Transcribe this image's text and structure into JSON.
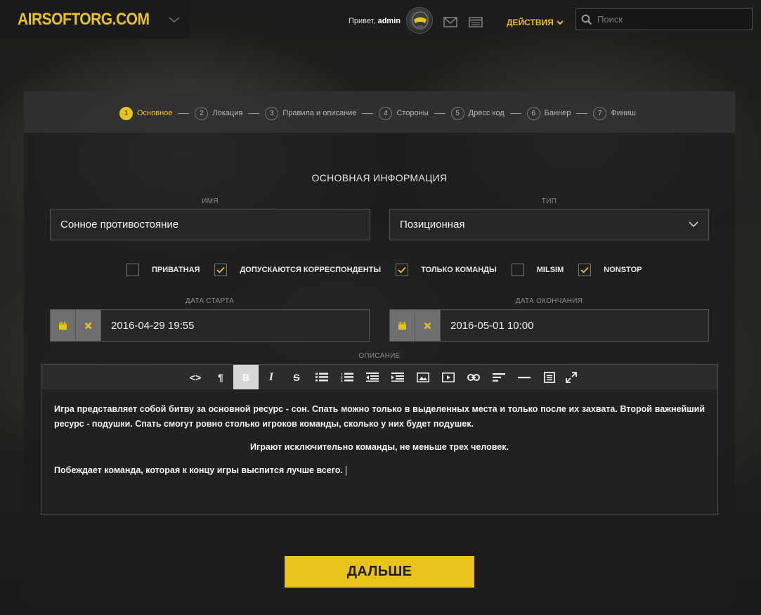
{
  "header": {
    "logo_text": "AIRSOFTORG.COM",
    "greeting_prefix": "Привет,",
    "username": "admin",
    "actions_label": "ДЕЙСТВИЯ",
    "search_placeholder": "Поиск",
    "icons": [
      "chevron-down-icon",
      "avatar",
      "mail-icon",
      "news-icon",
      "search-icon"
    ]
  },
  "steps": [
    {
      "num": "1",
      "label": "Основное",
      "active": true
    },
    {
      "num": "2",
      "label": "Локация",
      "active": false
    },
    {
      "num": "3",
      "label": "Правила и описание",
      "active": false
    },
    {
      "num": "4",
      "label": "Стороны",
      "active": false
    },
    {
      "num": "5",
      "label": "Дресс код",
      "active": false
    },
    {
      "num": "6",
      "label": "Баннер",
      "active": false
    },
    {
      "num": "7",
      "label": "Финиш",
      "active": false
    }
  ],
  "form": {
    "section_title": "ОСНОВНАЯ ИНФОРМАЦИЯ",
    "name_label": "ИМЯ",
    "name_value": "Сонное противостояние",
    "type_label": "ТИП",
    "type_value": "Позиционная",
    "checkboxes": [
      {
        "label": "ПРИВАТНАЯ",
        "checked": false
      },
      {
        "label": "ДОПУСКАЮТСЯ КОРРЕСПОНДЕНТЫ",
        "checked": true
      },
      {
        "label": "ТОЛЬКО КОМАНДЫ",
        "checked": true
      },
      {
        "label": "MILSIM",
        "checked": false
      },
      {
        "label": "NONSTOP",
        "checked": true
      }
    ],
    "start_label": "ДАТА СТАРТА",
    "start_value": "2016-04-29 19:55",
    "end_label": "ДАТА ОКОНЧАНИЯ",
    "end_value": "2016-05-01 10:00",
    "description_label": "ОПИСАНИЕ",
    "description": {
      "p1": "Игра представляет собой битву за основной ресурс - сон. Спать можно только в выделенных места и только после их захвата. Второй важнейший ресурс - подушки. Спать смогут ровно столько игроков команды, сколько у них будет подушек.",
      "p2": "Играют исключительно команды, не меньше трех человек.",
      "p3": "Побеждает команда, которая к концу игры выспится лучше всего."
    },
    "toolbar_buttons": [
      "html",
      "formatting",
      "bold",
      "italic",
      "deleted",
      "unorderedlist",
      "orderedlist",
      "outdent",
      "indent",
      "image",
      "video",
      "link",
      "alignment",
      "horizontalrule",
      "fullscreen-fit",
      "fullscreen"
    ],
    "toolbar_glyphs": {
      "html": "<>",
      "formatting": "¶",
      "bold": "B",
      "italic": "I",
      "deleted": "S"
    },
    "next_label": "ДАЛЬШЕ"
  },
  "colors": {
    "accent": "#e8c21d",
    "panel": "#1c1c1c",
    "stepbar": "#343434"
  }
}
